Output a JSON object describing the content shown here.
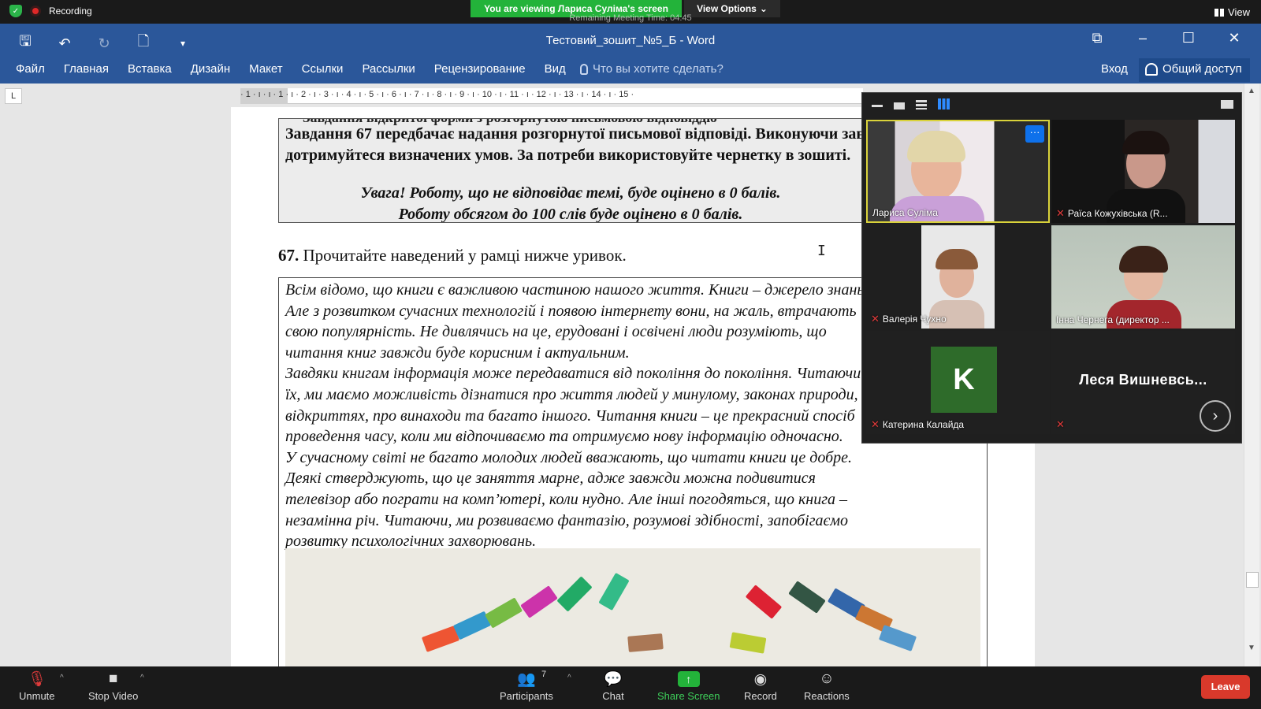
{
  "zoom_top": {
    "recording_label": "Recording",
    "viewing_banner": "You are viewing Лариса Суліма's screen",
    "view_options": "View Options",
    "remaining_time": "Remaining Meeting Time: 04:45",
    "view_label": "View"
  },
  "word": {
    "window_title": "Тестовий_зошит_№5_Б - Word",
    "tabs": [
      "Файл",
      "Главная",
      "Вставка",
      "Дизайн",
      "Макет",
      "Ссылки",
      "Рассылки",
      "Рецензирование",
      "Вид"
    ],
    "tell_me_placeholder": "Что вы хотите сделать?",
    "sign_in": "Вход",
    "share": "Общий доступ",
    "ruler_left": "L",
    "ruler_numbers": "· 1 · ı · ı · 1 · ı · 2 · ı · 3 · ı · 4 · ı · 5 · ı · 6 · ı · 7 · ı · 8 · ı · 9 · ı · 10 · ı · 11 · ı · 12 · ı · 13 · ı · 14 · ı · 15 ·"
  },
  "document": {
    "task_box_top_cut": "Завдання відкритої форми з розгорнутою письмовою відповіддю",
    "task_box_text": "Завдання 67 передбачає надання розгорнутої письмової відповіді. Виконуючи завдання, чітко дотримуйтеся визначених умов. За потреби використовуйте чернетку в зошиті.",
    "warning_1": "Увага! Роботу, що не відповідає темі, буде оцінено в 0 балів.",
    "warning_2": "Роботу обсягом до 100 слів буде оцінено в 0 балів.",
    "question_number": "67.",
    "question_text": "Прочитайте наведений у рамці нижче уривок.",
    "passage": [
      "Всім відомо, що книги є важливою частиною нашого життя. Книги – джерело знань.",
      "Але з розвитком сучасних технологій і появою інтернету вони, на жаль, втрачають",
      "свою популярність. Не дивлячись на це, ерудовані і освічені люди розуміють, що",
      "читання книг завжди буде корисним і актуальним.",
      "Завдяки книгам інформація може передаватися від покоління до покоління. Читаючи",
      "їх, ми маємо можливість дізнатися про життя людей у минулому, законах природи,",
      "відкриттях, про винаходи та багато іншого. Читання книги – це прекрасний спосіб",
      "проведення часу, коли ми відпочиваємо та отримуємо нову інформацію одночасно.",
      "У сучасному світі не багато молодих людей вважають, що читати книги це добре.",
      "Деякі стверджують, що це заняття марне, адже завжди можна подивитися",
      "телевізор або пограти на комп’ютері, коли нудно. Але інші погодяться, що книга –",
      "незамінна річ. Читаючи, ми розвиваємо фантазію, розумові здібності, запобігаємо",
      "розвитку психологічних захворювань."
    ]
  },
  "gallery": {
    "participants": [
      {
        "name": "Лариса Суліма",
        "muted": false,
        "active": true
      },
      {
        "name": "Раїса Кожухівська (R...",
        "muted": true,
        "active": false
      },
      {
        "name": "Валерія Чухно",
        "muted": true,
        "active": false
      },
      {
        "name": "Інна Чернега (директор ...",
        "muted": false,
        "active": false
      },
      {
        "name": "Катерина Калайда",
        "muted": true,
        "active": false,
        "avatar_letter": "K"
      },
      {
        "name": "Леся  Вишневсь...",
        "muted": true,
        "active": false
      }
    ],
    "more_button": "···",
    "next_icon": "chevron-right-icon"
  },
  "zoom_bottom": {
    "unmute": "Unmute",
    "stop_video": "Stop Video",
    "participants": "Participants",
    "participants_count": "7",
    "chat": "Chat",
    "share_screen": "Share Screen",
    "record": "Record",
    "reactions": "Reactions",
    "leave": "Leave"
  },
  "colors": {
    "word_blue": "#2b579a",
    "zoom_green": "#23b33a",
    "leave_red": "#d9392b",
    "active_speaker": "#d9d23a"
  }
}
